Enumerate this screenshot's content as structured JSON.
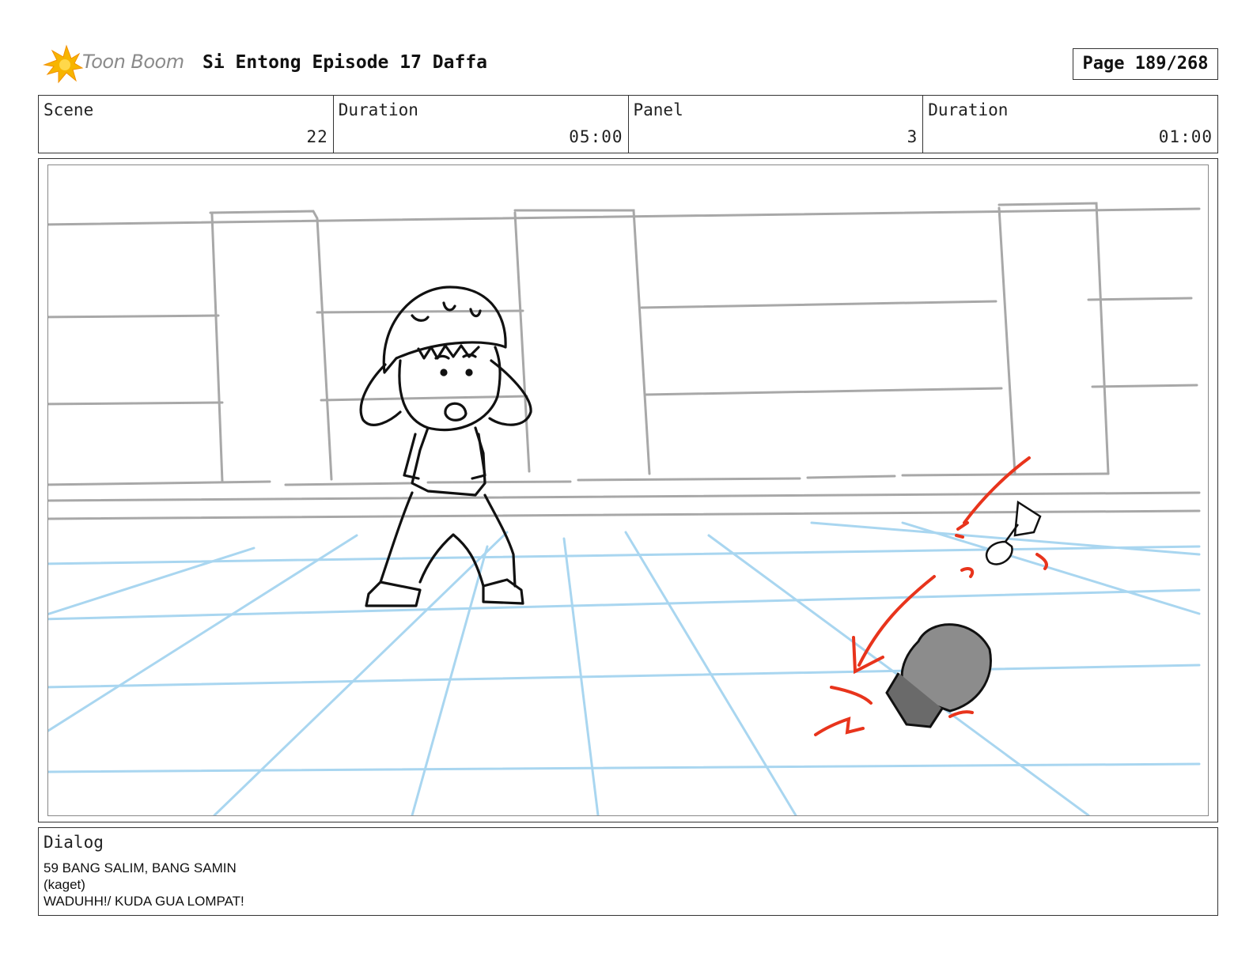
{
  "header": {
    "logo_text": "Toon Boom",
    "title": "Si Entong Episode 17 Daffa",
    "page": "Page 189/268"
  },
  "info": [
    {
      "label": "Scene",
      "value": "22"
    },
    {
      "label": "Duration",
      "value": "05:00"
    },
    {
      "label": "Panel",
      "value": "3"
    },
    {
      "label": "Duration",
      "value": "01:00"
    }
  ],
  "dialog": {
    "label": "Dialog",
    "lines": [
      "59 BANG SALIM, BANG SAMIN",
      "(kaget)",
      "WADUHH!/ KUDA GUA LOMPAT!"
    ]
  },
  "colors": {
    "sketch": "#111111",
    "background_lines": "#a8a8a8",
    "floor_grid": "#a9d6f0",
    "accent": "#e8341c",
    "prop_fill": "#8c8c8c"
  }
}
